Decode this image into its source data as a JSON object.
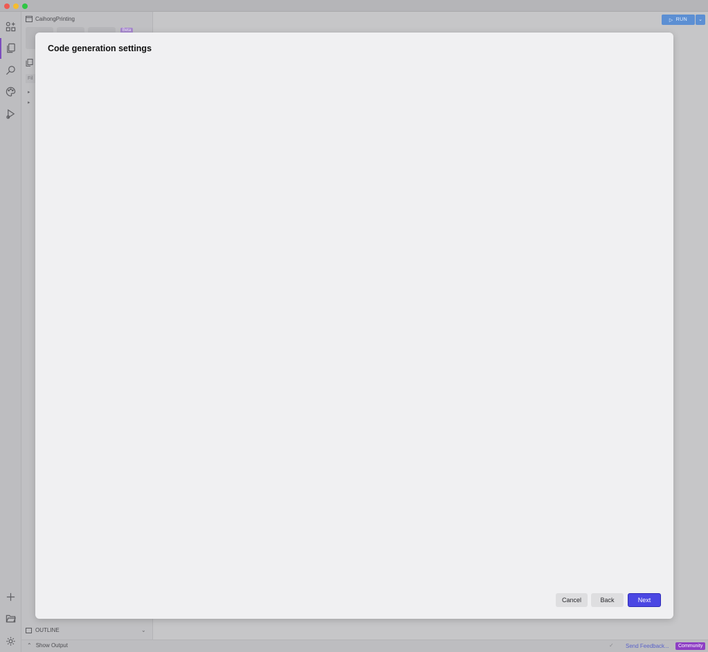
{
  "window": {
    "controls": [
      "close",
      "minimize",
      "maximize"
    ]
  },
  "activity_bar": {
    "icons": [
      "add-shapes-icon",
      "files-icon",
      "search-icon",
      "palette-icon",
      "run-debug-icon",
      "plus-icon",
      "folder-open-icon",
      "gear-icon"
    ],
    "active": "files-icon"
  },
  "sidebar": {
    "project_name": "CaihongPrinting",
    "beta_badge": "Beta",
    "filter_placeholder": "Fil",
    "outline_label": "OUTLINE"
  },
  "toolbar": {
    "run_label": "RUN"
  },
  "statusbar": {
    "show_output": "Show Output",
    "send_feedback": "Send Feedback...",
    "community": "Community"
  },
  "dialog": {
    "title": "Code generation settings",
    "cancel_label": "Cancel",
    "back_label": "Back",
    "next_label": "Next"
  },
  "colors": {
    "accent": "#4b47e3",
    "run_button": "#5c8fd3",
    "community_badge": "#8e3fc4",
    "active_indicator": "#7c4dbd"
  }
}
